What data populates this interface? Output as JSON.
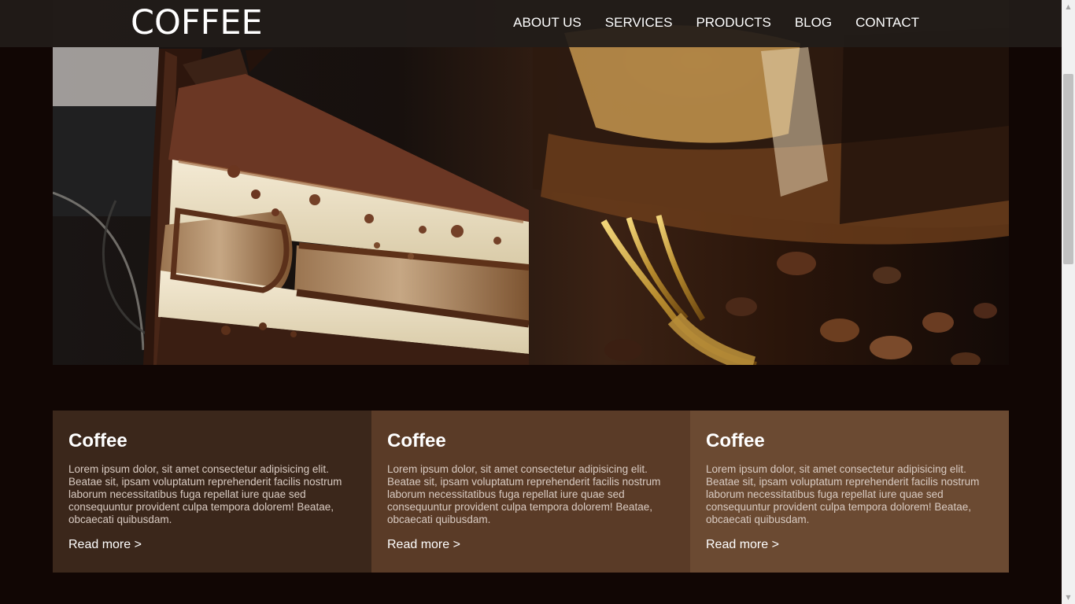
{
  "brand": {
    "name": "COFFEE",
    "text_color": "#ffffff"
  },
  "nav": {
    "items": [
      {
        "label": "ABOUT US"
      },
      {
        "label": "SERVICES"
      },
      {
        "label": "PRODUCTS"
      },
      {
        "label": "BLOG"
      },
      {
        "label": "CONTACT"
      }
    ]
  },
  "hero": {
    "image_icon": "tiramisu-cake-slice-with-fork-and-coffee-beans"
  },
  "cards": [
    {
      "title": "Coffee",
      "body": "Lorem ipsum dolor, sit amet consectetur adipisicing elit. Beatae sit, ipsam voluptatum reprehenderit facilis nostrum laborum necessitatibus fuga repellat iure quae sed consequuntur provident culpa tempora dolorem! Beatae, obcaecati quibusdam.",
      "link": "Read more >",
      "background": "#3b271b"
    },
    {
      "title": "Coffee",
      "body": "Lorem ipsum dolor, sit amet consectetur adipisicing elit. Beatae sit, ipsam voluptatum reprehenderit facilis nostrum laborum necessitatibus fuga repellat iure quae sed consequuntur provident culpa tempora dolorem! Beatae, obcaecati quibusdam.",
      "link": "Read more >",
      "background": "#5a3b27"
    },
    {
      "title": "Coffee",
      "body": "Lorem ipsum dolor, sit amet consectetur adipisicing elit. Beatae sit, ipsam voluptatum reprehenderit facilis nostrum laborum necessitatibus fuga repellat iure quae sed consequuntur provident culpa tempora dolorem! Beatae, obcaecati quibusdam.",
      "link": "Read more >",
      "background": "#6b4a32"
    }
  ],
  "scrollbar": {
    "up_icon": "triangle-up-icon",
    "down_icon": "triangle-down-icon"
  },
  "colors": {
    "page_background": "#110604",
    "nav_background": "#221c19",
    "card_text": "#d9cbc2"
  }
}
